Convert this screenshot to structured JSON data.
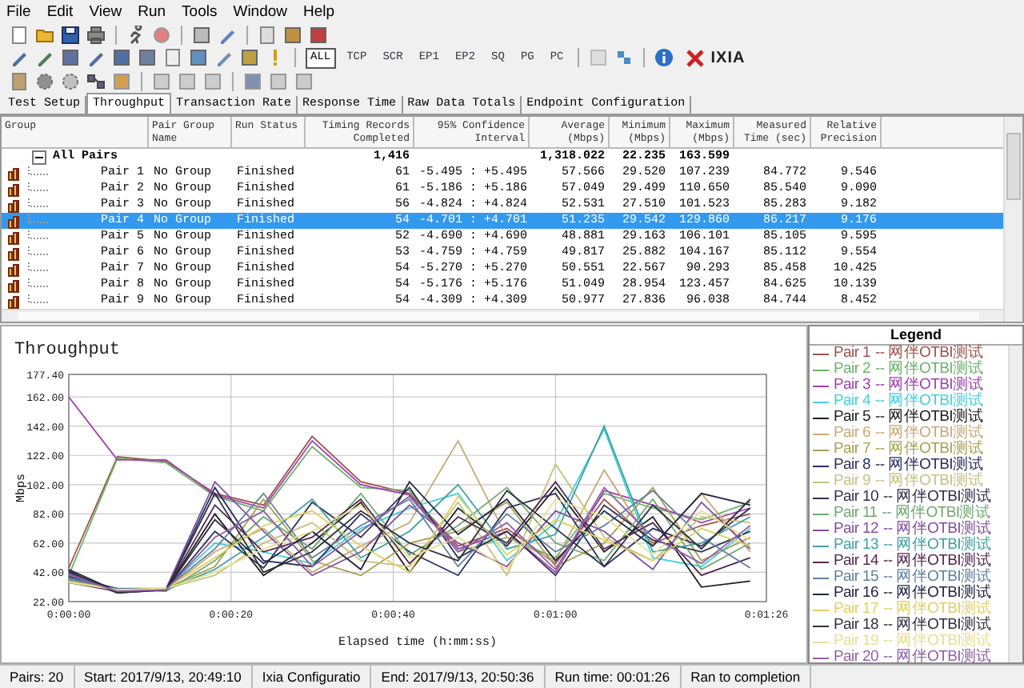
{
  "menu": [
    "File",
    "Edit",
    "View",
    "Run",
    "Tools",
    "Window",
    "Help"
  ],
  "toolbar_filters": [
    {
      "label": "ALL",
      "selected": true
    },
    {
      "label": "TCP",
      "selected": false
    },
    {
      "label": "SCR",
      "selected": false
    },
    {
      "label": "EP1",
      "selected": false
    },
    {
      "label": "EP2",
      "selected": false
    },
    {
      "label": "SQ",
      "selected": false
    },
    {
      "label": "PG",
      "selected": false
    },
    {
      "label": "PC",
      "selected": false
    }
  ],
  "logo": "IXIA",
  "tabs": [
    {
      "label": "Test Setup",
      "selected": false
    },
    {
      "label": "Throughput",
      "selected": true
    },
    {
      "label": "Transaction Rate",
      "selected": false
    },
    {
      "label": "Response Time",
      "selected": false
    },
    {
      "label": "Raw Data Totals",
      "selected": false
    },
    {
      "label": "Endpoint Configuration",
      "selected": false
    }
  ],
  "table": {
    "columns": [
      "Group",
      "Pair Group Name",
      "Run Status",
      "Timing Records Completed",
      "95% Confidence Interval",
      "Average (Mbps)",
      "Minimum (Mbps)",
      "Maximum (Mbps)",
      "Measured Time (sec)",
      "Relative Precision"
    ],
    "summary": {
      "expanded": true,
      "cells": [
        "All Pairs",
        "",
        "",
        "1,416",
        "",
        "1,318.022",
        "22.235",
        "163.599",
        "",
        ""
      ]
    },
    "rows": [
      {
        "selected": false,
        "cells": [
          "Pair 1",
          "No Group",
          "Finished",
          "61",
          "-5.495 : +5.495",
          "57.566",
          "29.520",
          "107.239",
          "84.772",
          "9.546"
        ]
      },
      {
        "selected": false,
        "cells": [
          "Pair 2",
          "No Group",
          "Finished",
          "61",
          "-5.186 : +5.186",
          "57.049",
          "29.499",
          "110.650",
          "85.540",
          "9.090"
        ]
      },
      {
        "selected": false,
        "cells": [
          "Pair 3",
          "No Group",
          "Finished",
          "56",
          "-4.824 : +4.824",
          "52.531",
          "27.510",
          "101.523",
          "85.283",
          "9.182"
        ]
      },
      {
        "selected": true,
        "cells": [
          "Pair 4",
          "No Group",
          "Finished",
          "54",
          "-4.701 : +4.701",
          "51.235",
          "29.542",
          "129.860",
          "86.217",
          "9.176"
        ]
      },
      {
        "selected": false,
        "cells": [
          "Pair 5",
          "No Group",
          "Finished",
          "52",
          "-4.690 : +4.690",
          "48.881",
          "29.163",
          "106.101",
          "85.105",
          "9.595"
        ]
      },
      {
        "selected": false,
        "cells": [
          "Pair 6",
          "No Group",
          "Finished",
          "53",
          "-4.759 : +4.759",
          "49.817",
          "25.882",
          "104.167",
          "85.112",
          "9.554"
        ]
      },
      {
        "selected": false,
        "cells": [
          "Pair 7",
          "No Group",
          "Finished",
          "54",
          "-5.270 : +5.270",
          "50.551",
          "22.567",
          "90.293",
          "85.458",
          "10.425"
        ]
      },
      {
        "selected": false,
        "cells": [
          "Pair 8",
          "No Group",
          "Finished",
          "54",
          "-5.176 : +5.176",
          "51.049",
          "28.954",
          "123.457",
          "84.625",
          "10.139"
        ]
      },
      {
        "selected": false,
        "cells": [
          "Pair 9",
          "No Group",
          "Finished",
          "54",
          "-4.309 : +4.309",
          "50.977",
          "27.836",
          "96.038",
          "84.744",
          "8.452"
        ]
      }
    ]
  },
  "chart": {
    "title": "Throughput",
    "chart_data": {
      "type": "line",
      "grid": true,
      "xlabel": "Elapsed time (h:mm:ss)",
      "ylabel": "Mbps",
      "x": [
        0,
        6,
        12,
        18,
        24,
        30,
        36,
        42,
        48,
        54,
        60,
        66,
        72,
        78,
        84
      ],
      "xlim": [
        0,
        86
      ],
      "ylim": [
        22,
        177.4
      ],
      "xticks": [
        {
          "value": 0,
          "label": "0:00:00"
        },
        {
          "value": 20,
          "label": "0:00:20"
        },
        {
          "value": 40,
          "label": "0:00:40"
        },
        {
          "value": 60,
          "label": "0:01:00"
        },
        {
          "value": 86,
          "label": "0:01:26"
        }
      ],
      "yticks": [
        {
          "value": 22,
          "label": "22.00"
        },
        {
          "value": 42,
          "label": "42.00"
        },
        {
          "value": 62,
          "label": "62.00"
        },
        {
          "value": 82,
          "label": "82.00"
        },
        {
          "value": 102,
          "label": "102.00"
        },
        {
          "value": 122,
          "label": "122.00"
        },
        {
          "value": 142,
          "label": "142.00"
        },
        {
          "value": 162,
          "label": "162.00"
        },
        {
          "value": 177.4,
          "label": "177.40"
        }
      ],
      "series": [
        {
          "name": "Pair 1",
          "color": "#a0524a",
          "values": [
            45,
            121,
            118,
            96,
            88,
            135,
            104,
            96,
            60,
            72,
            48,
            92,
            62,
            74,
            82
          ]
        },
        {
          "name": "Pair 2",
          "color": "#6ab36a",
          "values": [
            40,
            120,
            117,
            94,
            84,
            128,
            100,
            98,
            56,
            66,
            52,
            96,
            86,
            78,
            90
          ]
        },
        {
          "name": "Pair 3",
          "color": "#a040b0",
          "values": [
            162,
            119,
            119,
            95,
            86,
            132,
            102,
            95,
            58,
            70,
            42,
            98,
            88,
            76,
            86
          ]
        },
        {
          "name": "Pair 4",
          "color": "#40d0e0",
          "values": [
            35,
            30,
            31,
            62,
            56,
            48,
            72,
            86,
            96,
            50,
            76,
            140,
            52,
            46,
            72
          ]
        },
        {
          "name": "Pair 5",
          "color": "#202020",
          "values": [
            40,
            28,
            30,
            82,
            40,
            62,
            90,
            42,
            86,
            60,
            100,
            56,
            80,
            32,
            36
          ]
        },
        {
          "name": "Pair 6",
          "color": "#c8a878",
          "values": [
            38,
            29,
            30,
            56,
            72,
            42,
            60,
            76,
            132,
            66,
            50,
            112,
            60,
            96,
            56
          ]
        },
        {
          "name": "Pair 7",
          "color": "#a8a050",
          "values": [
            36,
            30,
            31,
            46,
            92,
            50,
            40,
            62,
            70,
            90,
            46,
            62,
            100,
            50,
            66
          ]
        },
        {
          "name": "Pair 8",
          "color": "#283060",
          "values": [
            42,
            29,
            30,
            100,
            50,
            46,
            82,
            56,
            40,
            86,
            96,
            46,
            72,
            60,
            86
          ]
        },
        {
          "name": "Pair 9",
          "color": "#c8c080",
          "values": [
            37,
            30,
            31,
            40,
            62,
            76,
            50,
            46,
            90,
            40,
            116,
            66,
            50,
            80,
            76
          ]
        },
        {
          "name": "Pair 10",
          "color": "#303050",
          "values": [
            39,
            31,
            30,
            70,
            45,
            90,
            66,
            100,
            52,
            70,
            40,
            88,
            64,
            56,
            70
          ]
        },
        {
          "name": "Pair 11",
          "color": "#70a870",
          "values": [
            36,
            30,
            29,
            50,
            80,
            58,
            96,
            54,
            74,
            100,
            62,
            50,
            92,
            44,
            62
          ]
        },
        {
          "name": "Pair 12",
          "color": "#8050a0",
          "values": [
            41,
            28,
            31,
            104,
            70,
            40,
            56,
            88,
            62,
            46,
            84,
            70,
            44,
            90,
            58
          ]
        },
        {
          "name": "Pair 13",
          "color": "#40a0a0",
          "values": [
            38,
            30,
            30,
            44,
            66,
            92,
            52,
            70,
            102,
            58,
            68,
            142,
            56,
            62,
            80
          ]
        },
        {
          "name": "Pair 14",
          "color": "#502850",
          "values": [
            35,
            29,
            30,
            88,
            56,
            66,
            92,
            48,
            80,
            62,
            104,
            58,
            76,
            40,
            52
          ]
        },
        {
          "name": "Pair 15",
          "color": "#6080a0",
          "values": [
            37,
            31,
            31,
            58,
            96,
            52,
            74,
            92,
            46,
            82,
            56,
            74,
            98,
            66,
            45
          ]
        },
        {
          "name": "Pair 16",
          "color": "#202840",
          "values": [
            44,
            29,
            30,
            78,
            48,
            70,
            44,
            104,
            68,
            92,
            50,
            84,
            60,
            96,
            88
          ]
        },
        {
          "name": "Pair 17",
          "color": "#e0d060",
          "values": [
            36,
            30,
            31,
            52,
            74,
            84,
            60,
            42,
            94,
            54,
            78,
            64,
            50,
            72,
            60
          ]
        },
        {
          "name": "Pair 18",
          "color": "#303040",
          "values": [
            43,
            28,
            30,
            96,
            42,
            56,
            84,
            62,
            50,
            98,
            72,
            46,
            88,
            58,
            92
          ]
        },
        {
          "name": "Pair 19",
          "color": "#e8e090",
          "values": [
            35,
            30,
            31,
            42,
            58,
            70,
            88,
            52,
            66,
            44,
            92,
            80,
            54,
            84,
            64
          ]
        },
        {
          "name": "Pair 20",
          "color": "#9060a8",
          "values": [
            40,
            29,
            30,
            66,
            84,
            46,
            70,
            94,
            56,
            76,
            44,
            100,
            66,
            48,
            74
          ]
        }
      ]
    }
  },
  "legend": {
    "title": "Legend",
    "items": [
      {
        "text": "-- 网伴OTBI测试"
      },
      {
        "text": "-- 网伴OTBI测试"
      },
      {
        "text": "-- 网伴OTBI测试"
      },
      {
        "text": "-- 网伴OTBI测试"
      },
      {
        "text": "-- 网伴OTBI测试"
      },
      {
        "text": "-- 网伴OTBI测试"
      },
      {
        "text": "-- 网伴OTBI测试"
      },
      {
        "text": "-- 网伴OTBI测试"
      },
      {
        "text": "-- 网伴OTBI测试"
      },
      {
        "text": "-- 网伴OTBI测试"
      },
      {
        "text": "-- 网伴OTBI测试"
      },
      {
        "text": "-- 网伴OTBI测试"
      },
      {
        "text": "-- 网伴OTBI测试"
      },
      {
        "text": "-- 网伴OTBI测试"
      },
      {
        "text": "-- 网伴OTBI测试"
      },
      {
        "text": "-- 网伴OTBI测试"
      },
      {
        "text": "-- 网伴OTBI测试"
      },
      {
        "text": "-- 网伴OTBI测试"
      },
      {
        "text": "-- 网伴OTBI测试"
      },
      {
        "text": "-- 网伴OTBI测试"
      }
    ]
  },
  "status_bar": [
    "Pairs: 20",
    "Start: 2017/9/13, 20:49:10",
    "Ixia Configuratio",
    "End: 2017/9/13, 20:50:36",
    "Run time: 00:01:26",
    "Ran to completion"
  ]
}
